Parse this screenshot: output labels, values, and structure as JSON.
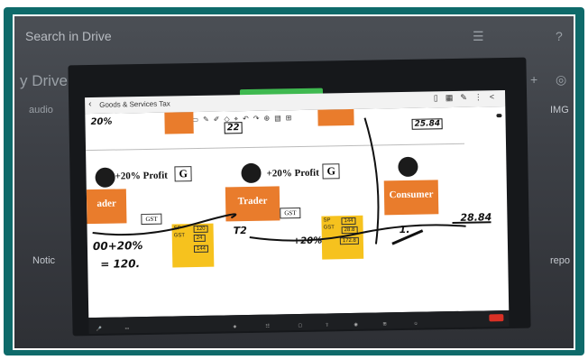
{
  "background": {
    "search_placeholder": "Search in Drive",
    "title": "y Drive",
    "audio": "audio",
    "notice": "Notic",
    "img": "IMG",
    "rep": "repo"
  },
  "meeting": {
    "recording_text": "",
    "notes_text": "",
    "tooltip": ""
  },
  "app": {
    "title": "Goods & Services Tax"
  },
  "whiteboard": {
    "profit_left": "+20% Profit",
    "profit_mid": "+20% Profit",
    "g_left": "G",
    "g_mid": "G",
    "role_left": "ader",
    "role_mid": "Trader",
    "role_right": "Consumer",
    "gst_left": "GST",
    "gst_mid": "GST",
    "box1": {
      "sp": "SP",
      "gst": "GST",
      "v1": "120",
      "v2": "24",
      "v3": "144"
    },
    "box2": {
      "sp": "SP",
      "gst": "GST",
      "v1": "144",
      "v2": "28.8",
      "v3": "172.8"
    },
    "hand": {
      "top_left": "20%",
      "top_mid": "22",
      "top_right": "25.84",
      "eq1": "00+20%",
      "eq2": "= 120.",
      "t2": "T2",
      "pct": "+20%",
      "one": "1.",
      "result": "28.84"
    }
  },
  "colors": {
    "frame": "#0e6a6a",
    "card": "#e97c2c",
    "price_box": "#f6c21e"
  }
}
